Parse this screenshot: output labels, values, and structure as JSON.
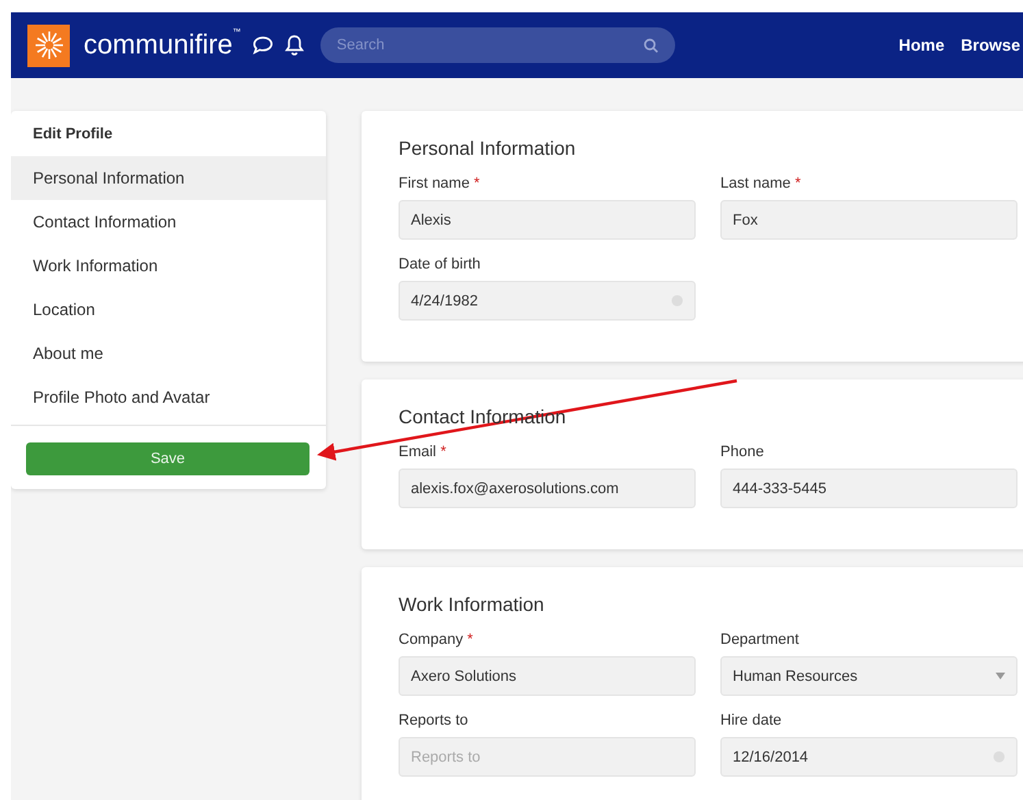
{
  "header": {
    "logo_text": "communifire",
    "logo_mark": "™",
    "search": {
      "placeholder": "Search"
    },
    "nav": [
      "Home",
      "Browse"
    ]
  },
  "sidebar": {
    "title": "Edit Profile",
    "items": [
      {
        "label": "Personal Information",
        "selected": true
      },
      {
        "label": "Contact Information",
        "selected": false
      },
      {
        "label": "Work Information",
        "selected": false
      },
      {
        "label": "Location",
        "selected": false
      },
      {
        "label": "About me",
        "selected": false
      },
      {
        "label": "Profile Photo and Avatar",
        "selected": false
      }
    ],
    "save_button": "Save"
  },
  "sections": [
    {
      "title": "Personal Information",
      "fields": [
        {
          "label": "First name",
          "required": true,
          "kind": "text",
          "value": "Alexis"
        },
        {
          "label": "Last name",
          "required": true,
          "kind": "text",
          "value": "Fox"
        },
        {
          "label": "Date of birth",
          "required": false,
          "kind": "date",
          "value": "4/24/1982"
        }
      ]
    },
    {
      "title": "Contact Information",
      "fields": [
        {
          "label": "Email",
          "required": true,
          "kind": "text",
          "value": "alexis.fox@axerosolutions.com"
        },
        {
          "label": "Phone",
          "required": false,
          "kind": "text",
          "value": "444-333-5445"
        }
      ]
    },
    {
      "title": "Work Information",
      "fields": [
        {
          "label": "Company",
          "required": true,
          "kind": "text",
          "value": "Axero Solutions"
        },
        {
          "label": "Department",
          "required": false,
          "kind": "select",
          "value": "Human Resources"
        },
        {
          "label": "Reports to",
          "required": false,
          "kind": "text",
          "placeholder": "Reports to"
        },
        {
          "label": "Hire date",
          "required": false,
          "kind": "date",
          "value": "12/16/2014"
        }
      ]
    }
  ],
  "required_mark": "*"
}
